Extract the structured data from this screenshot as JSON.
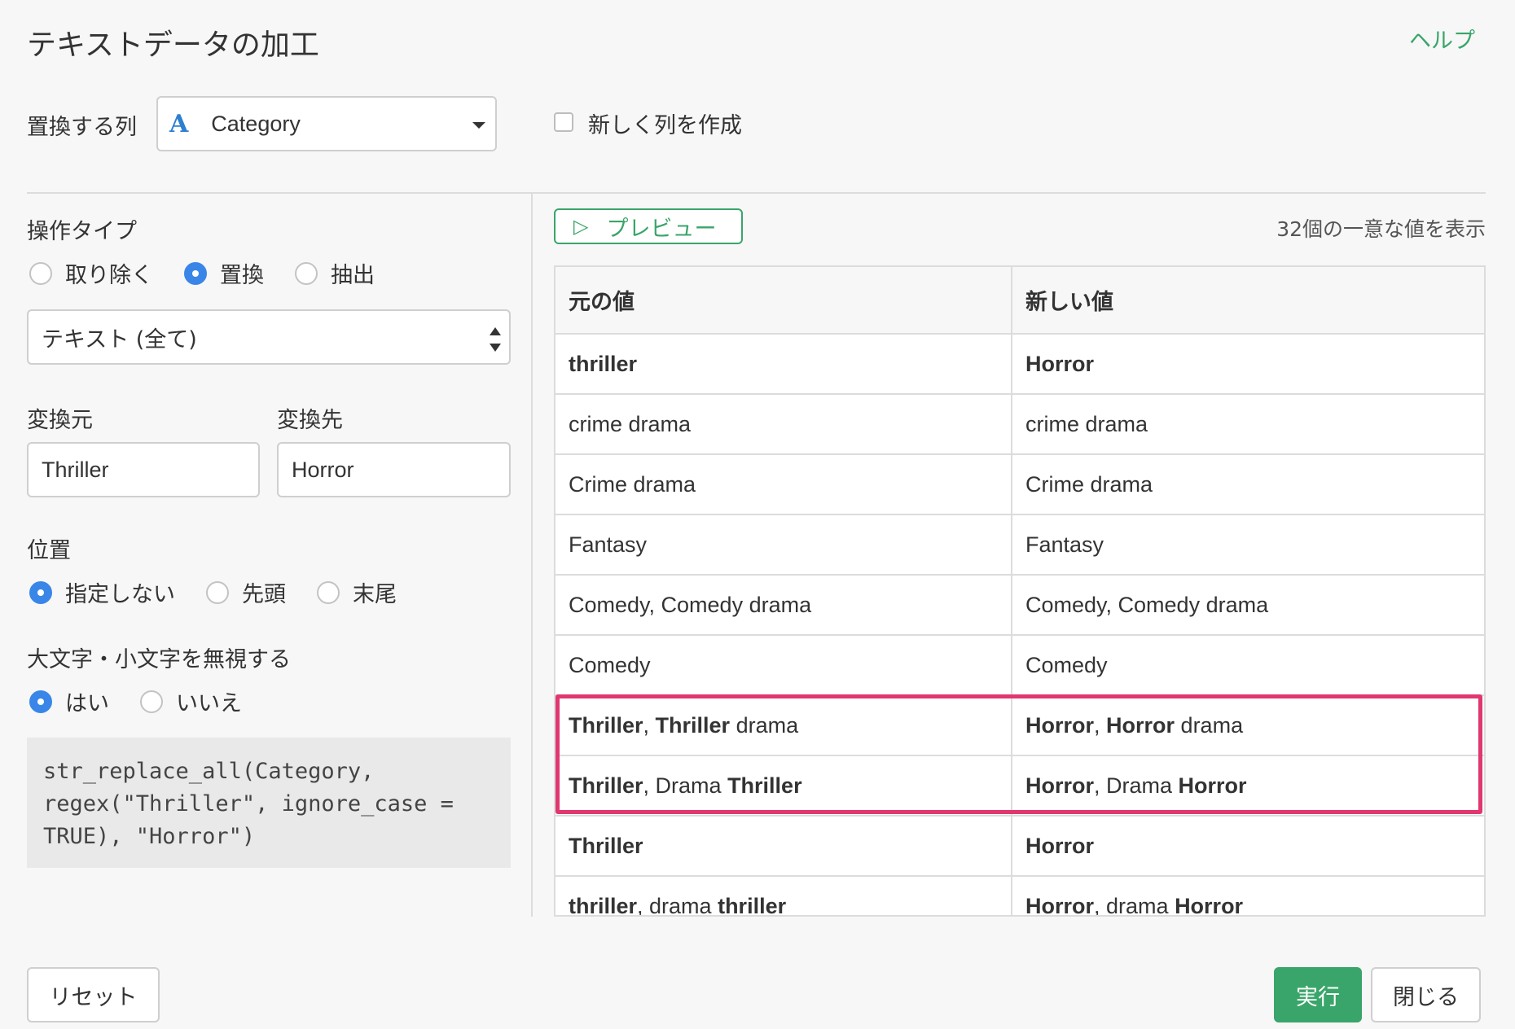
{
  "dialog": {
    "title": "テキストデータの加工",
    "help_label": "ヘルプ"
  },
  "column_row": {
    "label": "置換する列",
    "type_icon": "A",
    "selected_column": "Category",
    "new_column_label": "新しく列を作成",
    "new_column_checked": false
  },
  "operation": {
    "label": "操作タイプ",
    "options": [
      "取り除く",
      "置換",
      "抽出"
    ],
    "selected": "置換"
  },
  "mode_select": {
    "value": "テキスト (全て)"
  },
  "replace": {
    "from_label": "変換元",
    "from_value": "Thriller",
    "to_label": "変換先",
    "to_value": "Horror"
  },
  "position": {
    "label": "位置",
    "options": [
      "指定しない",
      "先頭",
      "末尾"
    ],
    "selected": "指定しない"
  },
  "ignore_case": {
    "label": "大文字・小文字を無視する",
    "options": [
      "はい",
      "いいえ"
    ],
    "selected": "はい"
  },
  "code": {
    "lines": [
      "str_replace_all(Category,",
      "regex(\"Thriller\", ignore_case =",
      "TRUE), \"Horror\")"
    ]
  },
  "preview": {
    "button_label": "プレビュー",
    "unique_count_text": "32個の一意な値を表示",
    "columns": [
      "元の値",
      "新しい値"
    ],
    "rows": [
      {
        "original": [
          {
            "t": "thriller",
            "b": true
          }
        ],
        "new": [
          {
            "t": "Horror",
            "b": true
          }
        ]
      },
      {
        "original": [
          {
            "t": "crime drama",
            "b": false
          }
        ],
        "new": [
          {
            "t": "crime drama",
            "b": false
          }
        ]
      },
      {
        "original": [
          {
            "t": "Crime drama",
            "b": false
          }
        ],
        "new": [
          {
            "t": "Crime drama",
            "b": false
          }
        ]
      },
      {
        "original": [
          {
            "t": "Fantasy",
            "b": false
          }
        ],
        "new": [
          {
            "t": "Fantasy",
            "b": false
          }
        ]
      },
      {
        "original": [
          {
            "t": "Comedy, Comedy drama",
            "b": false
          }
        ],
        "new": [
          {
            "t": "Comedy, Comedy drama",
            "b": false
          }
        ]
      },
      {
        "original": [
          {
            "t": "Comedy",
            "b": false
          }
        ],
        "new": [
          {
            "t": "Comedy",
            "b": false
          }
        ]
      },
      {
        "original": [
          {
            "t": "Thriller",
            "b": true
          },
          {
            "t": ", ",
            "b": false
          },
          {
            "t": "Thriller",
            "b": true
          },
          {
            "t": " drama",
            "b": false
          }
        ],
        "new": [
          {
            "t": "Horror",
            "b": true
          },
          {
            "t": ", ",
            "b": false
          },
          {
            "t": "Horror",
            "b": true
          },
          {
            "t": " drama",
            "b": false
          }
        ]
      },
      {
        "original": [
          {
            "t": "Thriller",
            "b": true
          },
          {
            "t": ", Drama ",
            "b": false
          },
          {
            "t": "Thriller",
            "b": true
          }
        ],
        "new": [
          {
            "t": "Horror",
            "b": true
          },
          {
            "t": ", Drama ",
            "b": false
          },
          {
            "t": "Horror",
            "b": true
          }
        ]
      },
      {
        "original": [
          {
            "t": "Thriller",
            "b": true
          }
        ],
        "new": [
          {
            "t": "Horror",
            "b": true
          }
        ]
      },
      {
        "original": [
          {
            "t": "thriller",
            "b": true
          },
          {
            "t": ", drama ",
            "b": false
          },
          {
            "t": "thriller",
            "b": true
          }
        ],
        "new": [
          {
            "t": "Horror",
            "b": true
          },
          {
            "t": ", drama ",
            "b": false
          },
          {
            "t": "Horror",
            "b": true
          }
        ]
      }
    ]
  },
  "footer": {
    "reset_label": "リセット",
    "run_label": "実行",
    "close_label": "閉じる"
  },
  "colors": {
    "accent_green": "#3aa56a",
    "radio_blue": "#3a86e8",
    "highlight_pink": "#e0376f"
  }
}
